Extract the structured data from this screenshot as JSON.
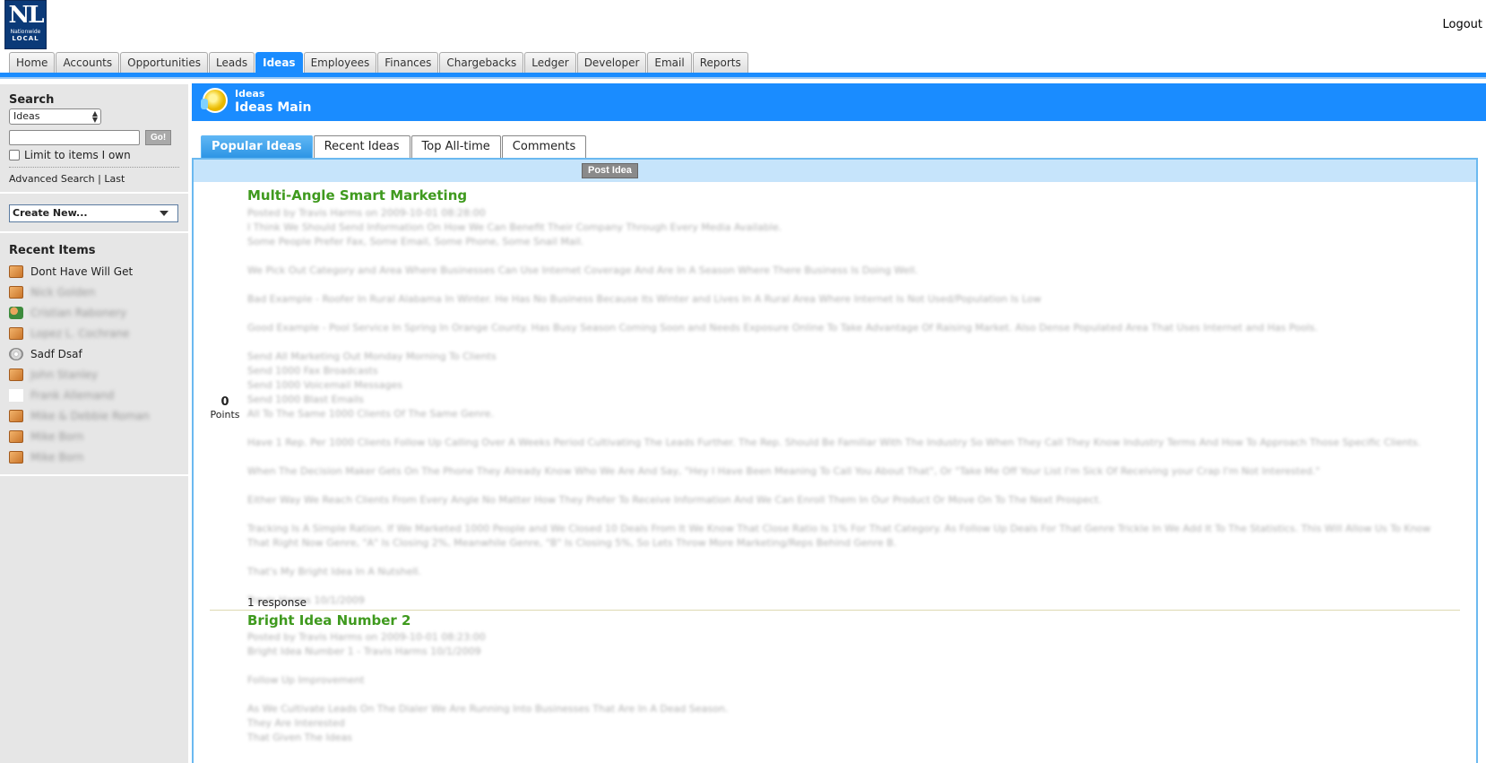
{
  "header": {
    "logo": {
      "line1": "NL",
      "line2": "Nationwide",
      "line3": "LOCAL"
    },
    "logout_label": "Logout"
  },
  "nav": {
    "tabs": [
      {
        "label": "Home"
      },
      {
        "label": "Accounts"
      },
      {
        "label": "Opportunities"
      },
      {
        "label": "Leads"
      },
      {
        "label": "Ideas"
      },
      {
        "label": "Employees"
      },
      {
        "label": "Finances"
      },
      {
        "label": "Chargebacks"
      },
      {
        "label": "Ledger"
      },
      {
        "label": "Developer"
      },
      {
        "label": "Email"
      },
      {
        "label": "Reports"
      }
    ],
    "active_index": 4
  },
  "sidebar": {
    "search_title": "Search",
    "search_scope": "Ideas",
    "search_value": "",
    "go_label": "Go!",
    "limit_label": "Limit to items I own",
    "advanced_label": "Advanced Search",
    "separator": "|",
    "last_label": "Last",
    "create_new_label": "Create New...",
    "recent_title": "Recent Items",
    "recent_items": [
      {
        "icon": "box-icon",
        "label": "Dont Have Will Get",
        "blurred": false
      },
      {
        "icon": "box-icon",
        "label": "Nick Golden",
        "blurred": true
      },
      {
        "icon": "people-icon",
        "label": "Cristian Rabonery",
        "blurred": true
      },
      {
        "icon": "box-icon",
        "label": "Lopez L. Cochrane",
        "blurred": true
      },
      {
        "icon": "disk-icon",
        "label": "Sadf Dsaf",
        "blurred": false
      },
      {
        "icon": "box-icon",
        "label": "John Stanley",
        "blurred": true
      },
      {
        "icon": "runner-icon",
        "label": "Frank Allemand",
        "blurred": true
      },
      {
        "icon": "box-icon",
        "label": "Mike & Debbie Roman",
        "blurred": true
      },
      {
        "icon": "box-icon",
        "label": "Mike Born",
        "blurred": true
      },
      {
        "icon": "box-icon",
        "label": "Mike Born",
        "blurred": true
      }
    ]
  },
  "page": {
    "breadcrumb": "Ideas",
    "title": "Ideas Main"
  },
  "subtabs": [
    {
      "label": "Popular Ideas"
    },
    {
      "label": "Recent Ideas"
    },
    {
      "label": "Top All-time"
    },
    {
      "label": "Comments"
    }
  ],
  "post_idea_label": "Post Idea",
  "ideas": [
    {
      "title": "Multi-Angle Smart Marketing",
      "points": "0",
      "points_label": "Points",
      "response": "1 response",
      "body": [
        "Posted by Travis Harms on 2009-10-01 08:28:00",
        "I Think We Should Send Information On How We Can Benefit Their Company Through Every Media Available.",
        "Some People Prefer Fax, Some Email, Some Phone, Some Snail Mail.",
        "",
        "We Pick Out Category and Area Where Businesses Can Use Internet Coverage And Are In A Season Where There Business Is Doing Well.",
        "",
        "Bad Example - Roofer In Rural Alabama In Winter. He Has No Business Because Its Winter and Lives In A Rural Area Where Internet Is Not Used/Population Is Low",
        "",
        "Good Example - Pool Service In Spring In Orange County. Has Busy Season Coming Soon and Needs Exposure Online To Take Advantage Of Raising Market. Also Dense Populated Area That Uses Internet and Has Pools.",
        "",
        "Send All Marketing Out Monday Morning To Clients",
        "Send 1000 Fax Broadcasts",
        "Send 1000 Voicemail Messages",
        "Send 1000 Blast Emails",
        "All To The Same 1000 Clients Of The Same Genre.",
        "",
        "Have 1 Rep. Per 1000 Clients Follow Up Calling Over A Weeks Period Cultivating The Leads Further. The Rep. Should Be Familiar With The Industry So When They Call They Know Industry Terms And How To Approach Those Specific Clients.",
        "",
        "When The Decision Maker Gets On The Phone They Already Know Who We Are And Say, \"Hey I Have Been Meaning To Call You About That\", Or \"Take Me Off Your List I'm Sick Of Receiving your Crap I'm Not Interested.\"",
        "",
        "Either Way We Reach Clients From Every Angle No Matter How They Prefer To Receive Information And We Can Enroll Them In Our Product Or Move On To The Next Prospect.",
        "",
        "Tracking Is A Simple Ration. If We Marketed 1000 People and We Closed 10 Deals From It We Know That Close Ratio Is 1% For That Category. As Follow Up Deals For That Genre Trickle In We Add It To The Statistics. This Will Allow Us To Know That Right Now Genre, \"A\" Is Closing 2%, Meanwhile Genre, \"B\" Is Closing 5%, So Lets Throw More Marketing/Reps Behind Genre B.",
        "",
        "That's My Bright Idea In A Nutshell.",
        "",
        "Travis Harms 10/1/2009"
      ]
    },
    {
      "title": "Bright Idea Number 2",
      "body": [
        "Posted by Travis Harms on 2009-10-01 08:23:00",
        "Bright Idea Number 1 - Travis Harms 10/1/2009",
        "",
        "Follow Up Improvement",
        "",
        "As We Cultivate Leads On The Dialer We Are Running Into Businesses That Are In A Dead Season.",
        "They Are Interested",
        "That Given The Ideas"
      ]
    }
  ]
}
